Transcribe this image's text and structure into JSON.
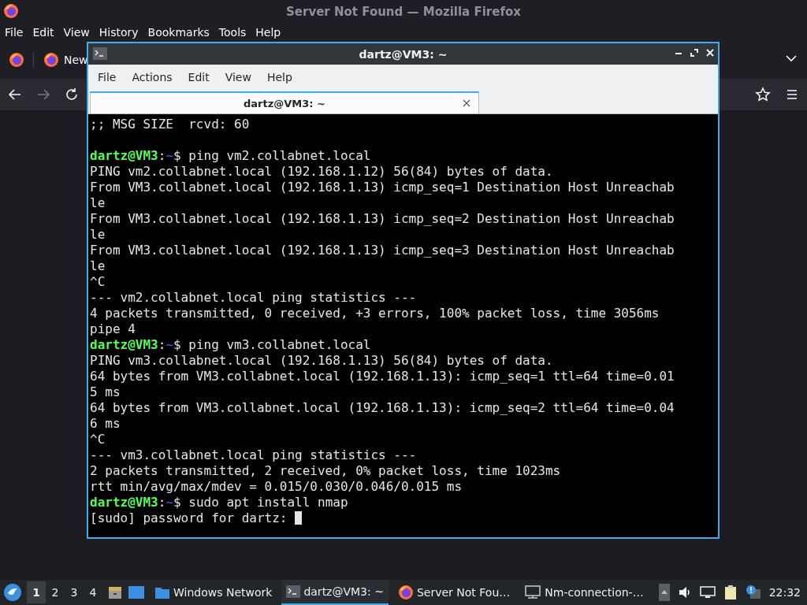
{
  "browser": {
    "title": "Server Not Found — Mozilla Firefox",
    "menu": [
      "File",
      "Edit",
      "View",
      "History",
      "Bookmarks",
      "Tools",
      "Help"
    ],
    "tab": {
      "label": "New"
    }
  },
  "terminal": {
    "title": "dartz@VM3: ~",
    "menu": [
      "File",
      "Actions",
      "Edit",
      "View",
      "Help"
    ],
    "tab": {
      "label": "dartz@VM3: ~",
      "selected": true
    },
    "lines": [
      {
        "kind": "output",
        "text": ";; MSG SIZE  rcvd: 60"
      },
      {
        "kind": "blank"
      },
      {
        "kind": "prompt",
        "user": "dartz@VM3",
        "separator": ":",
        "path": "~",
        "command": "$ ping vm2.collabnet.local"
      },
      {
        "kind": "output",
        "text": "PING vm2.collabnet.local (192.168.1.12) 56(84) bytes of data."
      },
      {
        "kind": "output",
        "text": "From VM3.collabnet.local (192.168.1.13) icmp_seq=1 Destination Host Unreachab"
      },
      {
        "kind": "output",
        "text": "le"
      },
      {
        "kind": "output",
        "text": "From VM3.collabnet.local (192.168.1.13) icmp_seq=2 Destination Host Unreachab"
      },
      {
        "kind": "output",
        "text": "le"
      },
      {
        "kind": "output",
        "text": "From VM3.collabnet.local (192.168.1.13) icmp_seq=3 Destination Host Unreachab"
      },
      {
        "kind": "output",
        "text": "le"
      },
      {
        "kind": "output",
        "text": "^C"
      },
      {
        "kind": "output",
        "text": "--- vm2.collabnet.local ping statistics ---"
      },
      {
        "kind": "output",
        "text": "4 packets transmitted, 0 received, +3 errors, 100% packet loss, time 3056ms"
      },
      {
        "kind": "output",
        "text": "pipe 4"
      },
      {
        "kind": "prompt",
        "user": "dartz@VM3",
        "separator": ":",
        "path": "~",
        "command": "$ ping vm3.collabnet.local"
      },
      {
        "kind": "output",
        "text": "PING vm3.collabnet.local (192.168.1.13) 56(84) bytes of data."
      },
      {
        "kind": "output",
        "text": "64 bytes from VM3.collabnet.local (192.168.1.13): icmp_seq=1 ttl=64 time=0.01"
      },
      {
        "kind": "output",
        "text": "5 ms"
      },
      {
        "kind": "output",
        "text": "64 bytes from VM3.collabnet.local (192.168.1.13): icmp_seq=2 ttl=64 time=0.04"
      },
      {
        "kind": "output",
        "text": "6 ms"
      },
      {
        "kind": "output",
        "text": "^C"
      },
      {
        "kind": "output",
        "text": "--- vm3.collabnet.local ping statistics ---"
      },
      {
        "kind": "output",
        "text": "2 packets transmitted, 2 received, 0% packet loss, time 1023ms"
      },
      {
        "kind": "output",
        "text": "rtt min/avg/max/mdev = 0.015/0.030/0.046/0.015 ms"
      },
      {
        "kind": "prompt",
        "user": "dartz@VM3",
        "separator": ":",
        "path": "~",
        "command": "$ sudo apt install nmap"
      },
      {
        "kind": "input",
        "text": "[sudo] password for dartz: ",
        "cursor": true
      }
    ]
  },
  "taskbar": {
    "workspaces": [
      {
        "label": "1",
        "selected": true
      },
      {
        "label": "2",
        "selected": false
      },
      {
        "label": "3",
        "selected": false
      },
      {
        "label": "4",
        "selected": false
      }
    ],
    "tasks": [
      {
        "kind": "folder",
        "label": "Windows Network",
        "selected": false
      },
      {
        "kind": "terminal",
        "label": "dartz@VM3: ~",
        "selected": true
      },
      {
        "kind": "browser",
        "label": "Server Not Fou…",
        "selected": false
      },
      {
        "kind": "network",
        "label": "Nm-connection-…",
        "selected": false
      }
    ],
    "clock": "22:32"
  }
}
